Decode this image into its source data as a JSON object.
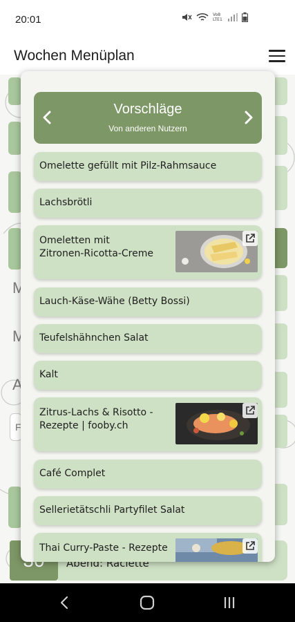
{
  "status": {
    "time": "20:01",
    "network_label": "Vo8 LTE1"
  },
  "app": {
    "title": "Wochen Menüplan"
  },
  "background": {
    "letters": [
      "M",
      "M",
      "A",
      "F"
    ],
    "bottom_day": "30",
    "bottom_meal": "Abend: Raclette"
  },
  "panel": {
    "title": "Vorschläge",
    "subtitle": "Von anderen Nutzern",
    "items": [
      {
        "label": "Omelette gefüllt mit Pilz-Rahmsauce",
        "has_image": false
      },
      {
        "label": "Lachsbrötli",
        "has_image": false
      },
      {
        "label": "Omeletten mit\nZitronen-Ricotta-Creme",
        "has_image": true,
        "image": "omelette-photo"
      },
      {
        "label": "Lauch-Käse-Wähe (Betty Bossi)",
        "has_image": false
      },
      {
        "label": "Teufelshähnchen Salat",
        "has_image": false
      },
      {
        "label": "Kalt",
        "has_image": false
      },
      {
        "label": "Zitrus-Lachs & Risotto -\nRezepte | fooby.ch",
        "has_image": true,
        "image": "salmon-photo"
      },
      {
        "label": "Café Complet",
        "has_image": false
      },
      {
        "label": "Sellerietätschli Partyfilet Salat",
        "has_image": false
      },
      {
        "label": "Thai Curry-Paste - Rezepte",
        "has_image": true,
        "image": "curry-photo"
      }
    ]
  },
  "colors": {
    "header_green": "#7d9766",
    "item_green": "#cfe1c5",
    "accent_block": "#a9c79c"
  }
}
